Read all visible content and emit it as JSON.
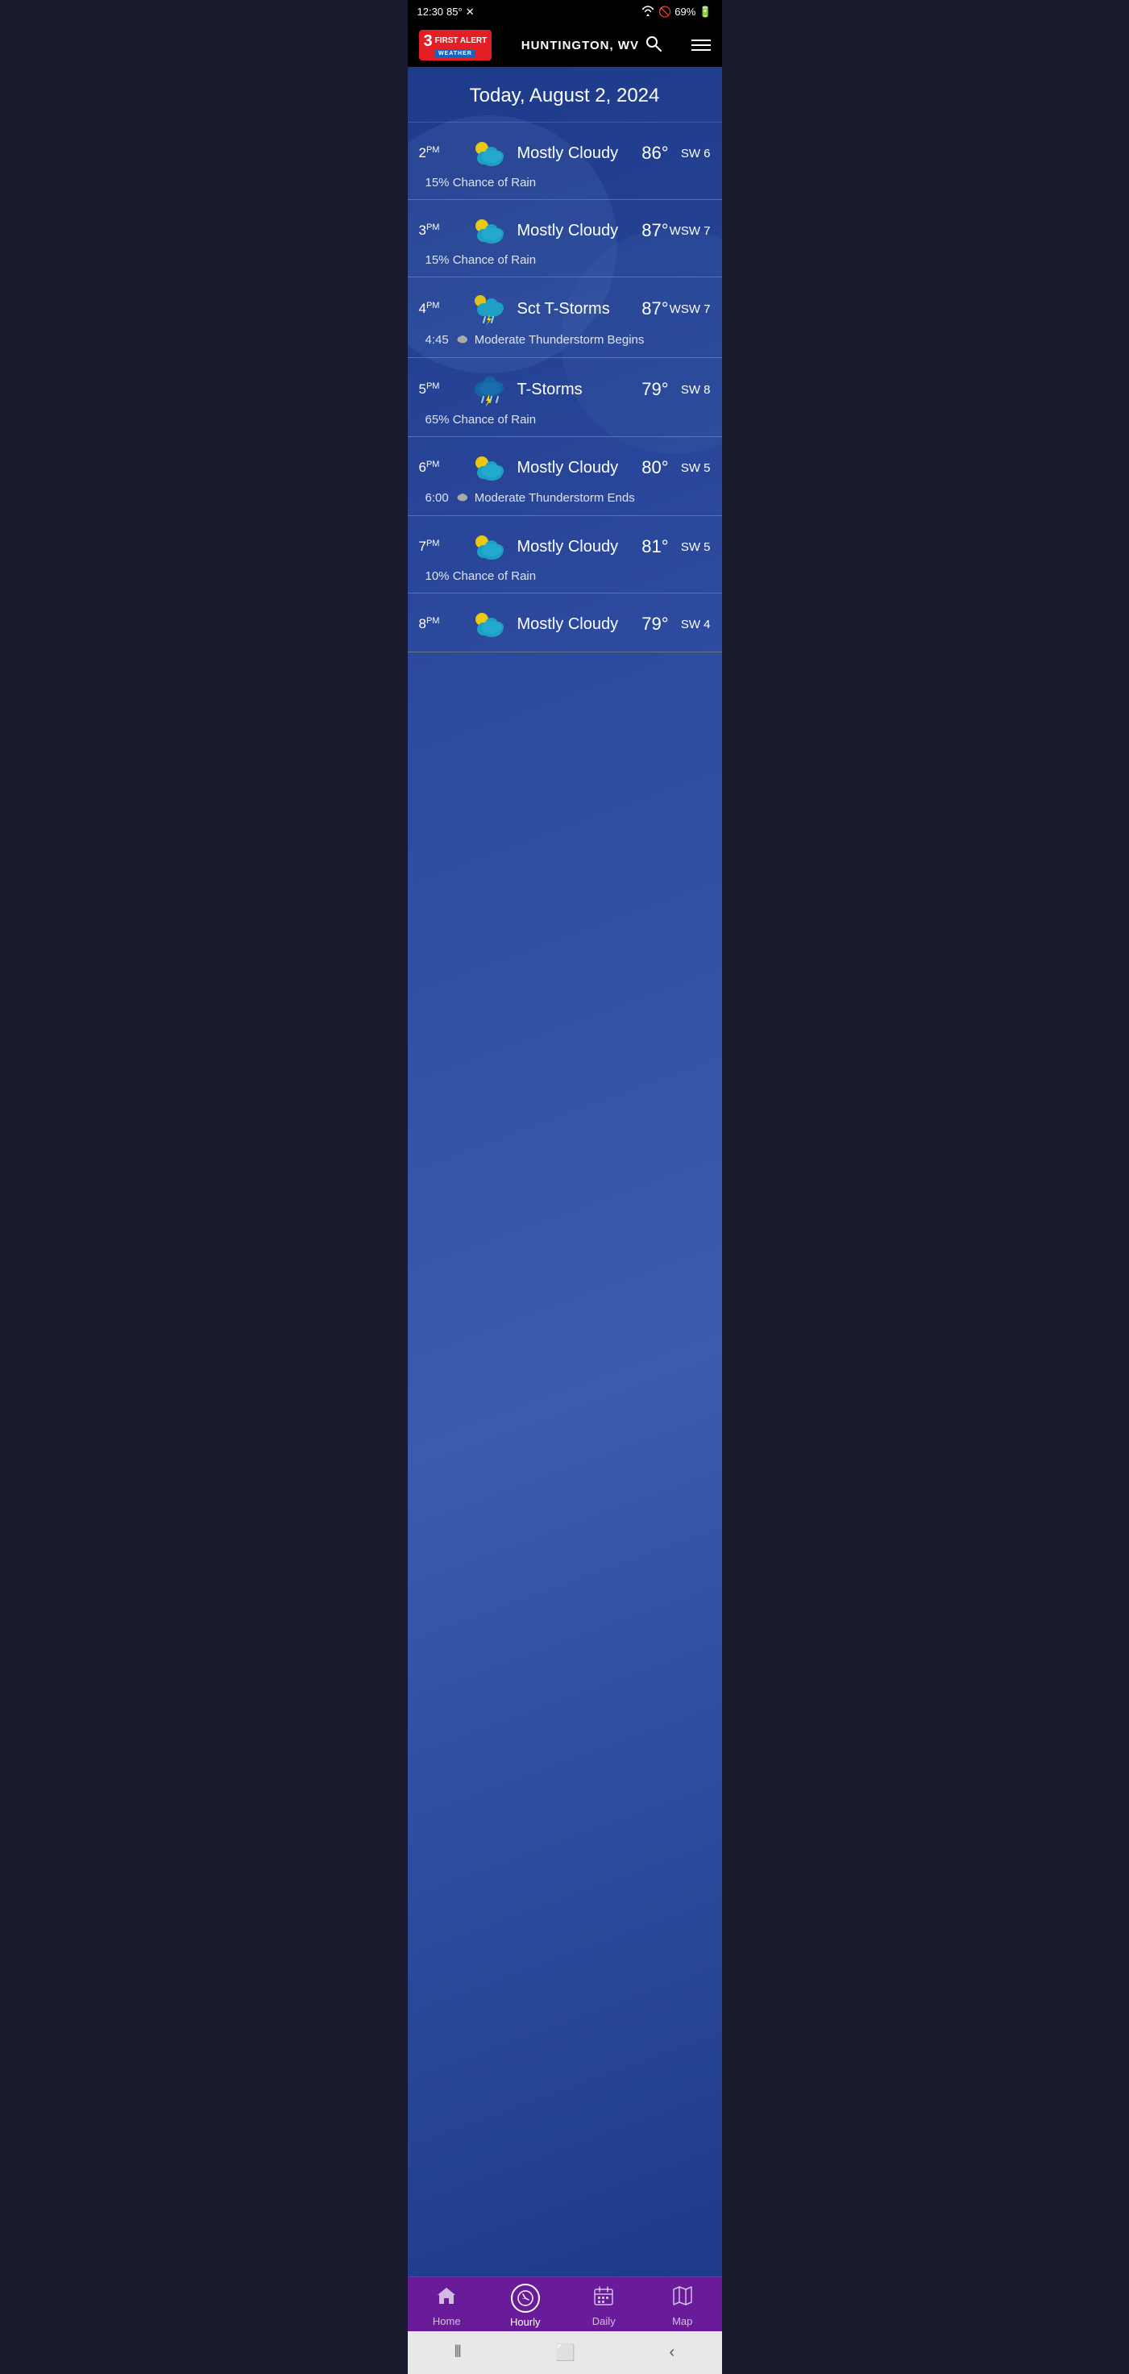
{
  "statusBar": {
    "time": "12:30",
    "temp": "85°",
    "battery": "69%"
  },
  "header": {
    "logoNumber": "3",
    "logoFirstAlert": "FIRST ALERT",
    "logoWeather": "WEATHER",
    "location": "HUNTINGTON, WV"
  },
  "dateHeader": "Today, August 2, 2024",
  "hourlyRows": [
    {
      "time": "2",
      "ampm": "PM",
      "condition": "Mostly Cloudy",
      "temp": "86°",
      "wind": "SW 6",
      "sub": "15% Chance of Rain",
      "subTime": null,
      "subAlert": null,
      "iconType": "mostly-cloudy-day"
    },
    {
      "time": "3",
      "ampm": "PM",
      "condition": "Mostly Cloudy",
      "temp": "87°",
      "wind": "WSW 7",
      "sub": "15% Chance of Rain",
      "subTime": null,
      "subAlert": null,
      "iconType": "mostly-cloudy-day"
    },
    {
      "time": "4",
      "ampm": "PM",
      "condition": "Sct T-Storms",
      "temp": "87°",
      "wind": "WSW 7",
      "sub": "Moderate Thunderstorm Begins",
      "subTime": "4:45",
      "subAlert": "⛈",
      "iconType": "tstorm-day"
    },
    {
      "time": "5",
      "ampm": "PM",
      "condition": "T-Storms",
      "temp": "79°",
      "wind": "SW 8",
      "sub": "65% Chance of Rain",
      "subTime": null,
      "subAlert": null,
      "iconType": "tstorm-night"
    },
    {
      "time": "6",
      "ampm": "PM",
      "condition": "Mostly Cloudy",
      "temp": "80°",
      "wind": "SW 5",
      "sub": "Moderate Thunderstorm Ends",
      "subTime": "6:00",
      "subAlert": "⛅",
      "iconType": "mostly-cloudy-day"
    },
    {
      "time": "7",
      "ampm": "PM",
      "condition": "Mostly Cloudy",
      "temp": "81°",
      "wind": "SW 5",
      "sub": "10% Chance of Rain",
      "subTime": null,
      "subAlert": null,
      "iconType": "mostly-cloudy-day"
    },
    {
      "time": "8",
      "ampm": "PM",
      "condition": "Mostly Cloudy",
      "temp": "79°",
      "wind": "SW 4",
      "sub": null,
      "subTime": null,
      "subAlert": null,
      "iconType": "mostly-cloudy-day"
    }
  ],
  "bottomNav": [
    {
      "label": "Home",
      "icon": "home",
      "active": false
    },
    {
      "label": "Hourly",
      "icon": "back-clock",
      "active": true
    },
    {
      "label": "Daily",
      "icon": "calendar",
      "active": false
    },
    {
      "label": "Map",
      "icon": "map",
      "active": false
    }
  ]
}
